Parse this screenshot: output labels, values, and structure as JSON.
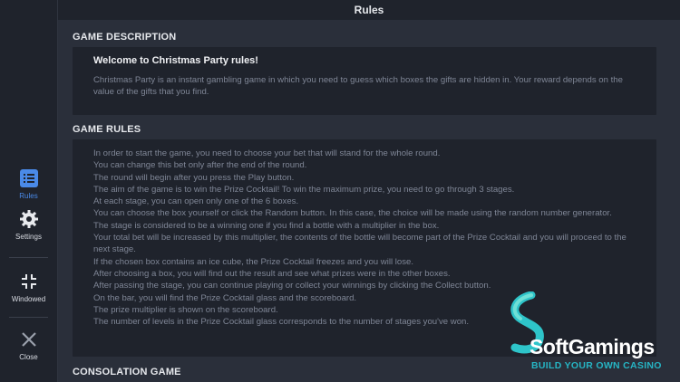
{
  "window": {
    "title": "Rules"
  },
  "sidebar": {
    "rules_label": "Rules",
    "settings_label": "Settings",
    "windowed_label": "Windowed",
    "close_label": "Close",
    "accent": "#4a8ae8"
  },
  "description": {
    "title": "GAME DESCRIPTION",
    "heading": "Welcome to Christmas Party rules!",
    "text": "Christmas Party is an instant gambling game in which you need to guess which boxes the gifts are hidden in. Your reward depends on the value of the gifts that you find."
  },
  "rules": {
    "title": "GAME RULES",
    "lines": [
      "In order to start the game, you need to choose your bet that will stand for the whole round.",
      "You can change this bet only after the end of the round.",
      "The round will begin after you press the Play button.",
      "The aim of the game is to win the Prize Cocktail! To win the maximum prize, you need to go through 3 stages.",
      "At each stage, you can open only one of the 6 boxes.",
      "You can choose the box yourself or click the Random button. In this case, the choice will be made using the random number generator.",
      "The stage is considered to be a winning one if you find a bottle with a multiplier in the box.",
      "Your total bet will be increased by this multiplier, the contents of the bottle will become part of the Prize Cocktail and you will proceed to the next stage.",
      "If the chosen box contains an ice cube, the Prize Cocktail freezes and you will lose.",
      "After choosing a box, you will find out the result and see what prizes were in the other boxes.",
      "After passing the stage, you can continue playing or collect your winnings by clicking the Collect button.",
      "On the bar, you will find the Prize Cocktail glass and the scoreboard.",
      "The prize multiplier is shown on the scoreboard.",
      "The number of levels in the Prize Cocktail glass corresponds to the number of stages you've won."
    ]
  },
  "consolation": {
    "title": "CONSOLATION GAME"
  },
  "watermark": {
    "brand": "SoftGamings",
    "tagline": "BUILD YOUR OWN CASINO"
  }
}
